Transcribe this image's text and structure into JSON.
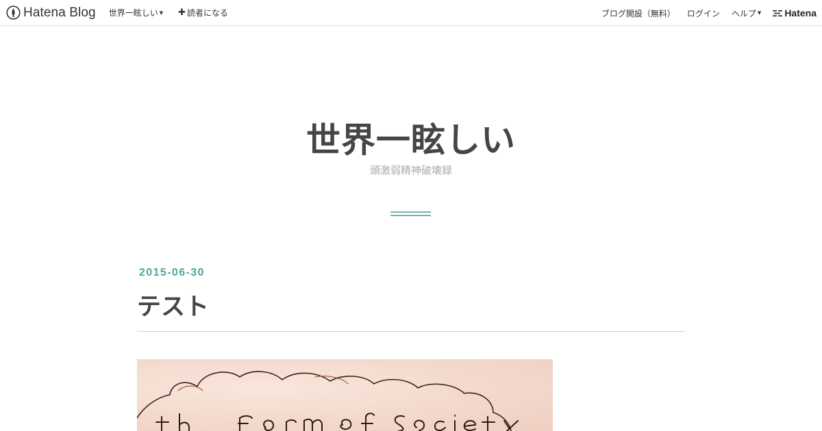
{
  "topbar": {
    "brand": "Hatena Blog",
    "blog_menu_label": "世界一眩しい",
    "subscribe_label": "読者になる",
    "create_blog_label": "ブログ開設（無料）",
    "login_label": "ログイン",
    "help_label": "ヘルプ",
    "hatena_label": "Hatena"
  },
  "blog": {
    "title": "世界一眩しい",
    "description": "頭激弱精神破壊録"
  },
  "entry": {
    "date": "2015-06-30",
    "title": "テスト",
    "image_handwritten_text": "the form of society"
  },
  "colors": {
    "accent": "#4aa69c",
    "divider": "#79b1ad",
    "title": "#454545",
    "description": "#aaaaaa",
    "image_background": "#f3d9cc",
    "ink": "#2a1a14"
  },
  "icons": {
    "brand": "hatena-blog-pen-icon",
    "caret": "caret-down-icon",
    "plus": "plus-icon",
    "hatena_mark": "hatena-mark-icon"
  }
}
